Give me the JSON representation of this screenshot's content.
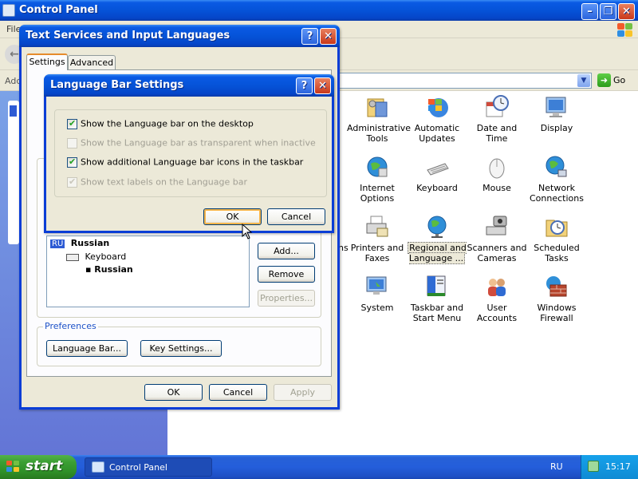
{
  "control_panel": {
    "title": "Control Panel",
    "menu_partial": "File",
    "address_partial": "Add",
    "go_label": "Go",
    "items": [
      {
        "label": "Administrative Tools",
        "icon": "administrative-tools-icon"
      },
      {
        "label": "Automatic Updates",
        "icon": "automatic-updates-icon"
      },
      {
        "label": "Date and Time",
        "icon": "date-time-icon"
      },
      {
        "label": "Display",
        "icon": "display-icon"
      },
      {
        "label": "Internet Options",
        "icon": "internet-options-icon"
      },
      {
        "label": "Keyboard",
        "icon": "keyboard-icon"
      },
      {
        "label": "Mouse",
        "icon": "mouse-icon"
      },
      {
        "label": "Network Connections",
        "icon": "network-connections-icon"
      },
      {
        "label": "Printers and Faxes",
        "icon": "printers-faxes-icon"
      },
      {
        "label": "Regional and Language ...",
        "icon": "globe-icon"
      },
      {
        "label": "Scanners and Cameras",
        "icon": "scanners-cameras-icon"
      },
      {
        "label": "Scheduled Tasks",
        "icon": "scheduled-tasks-icon"
      },
      {
        "label": "System",
        "icon": "system-icon"
      },
      {
        "label": "Taskbar and Start Menu",
        "icon": "taskbar-start-menu-icon"
      },
      {
        "label": "User Accounts",
        "icon": "user-accounts-icon"
      },
      {
        "label": "Windows Firewall",
        "icon": "firewall-icon"
      }
    ],
    "partial_text_ns": "ns"
  },
  "text_services": {
    "title": "Text Services and Input Languages",
    "tabs": [
      "Settings",
      "Advanced"
    ],
    "installed_language_code": "RU",
    "installed_language": "Russian",
    "installed_type": "Keyboard",
    "installed_layout": "Russian",
    "add_label": "Add...",
    "remove_label": "Remove",
    "properties_label": "Properties...",
    "preferences_legend": "Preferences",
    "language_bar_button": "Language Bar...",
    "key_settings_button": "Key Settings...",
    "ok_label": "OK",
    "cancel_label": "Cancel",
    "apply_label": "Apply"
  },
  "language_bar_dialog": {
    "title": "Language Bar Settings",
    "options": [
      {
        "label": "Show the Language bar on the desktop",
        "checked": true,
        "enabled": true
      },
      {
        "label": "Show the Language bar as transparent when inactive",
        "checked": false,
        "enabled": false
      },
      {
        "label": "Show additional Language bar icons in the taskbar",
        "checked": true,
        "enabled": true
      },
      {
        "label": "Show text labels on the Language bar",
        "checked": true,
        "enabled": false
      }
    ],
    "ok_label": "OK",
    "cancel_label": "Cancel"
  },
  "taskbar": {
    "start_label": "start",
    "task_label": "Control Panel",
    "language_indicator": "RU",
    "clock": "15:17"
  }
}
